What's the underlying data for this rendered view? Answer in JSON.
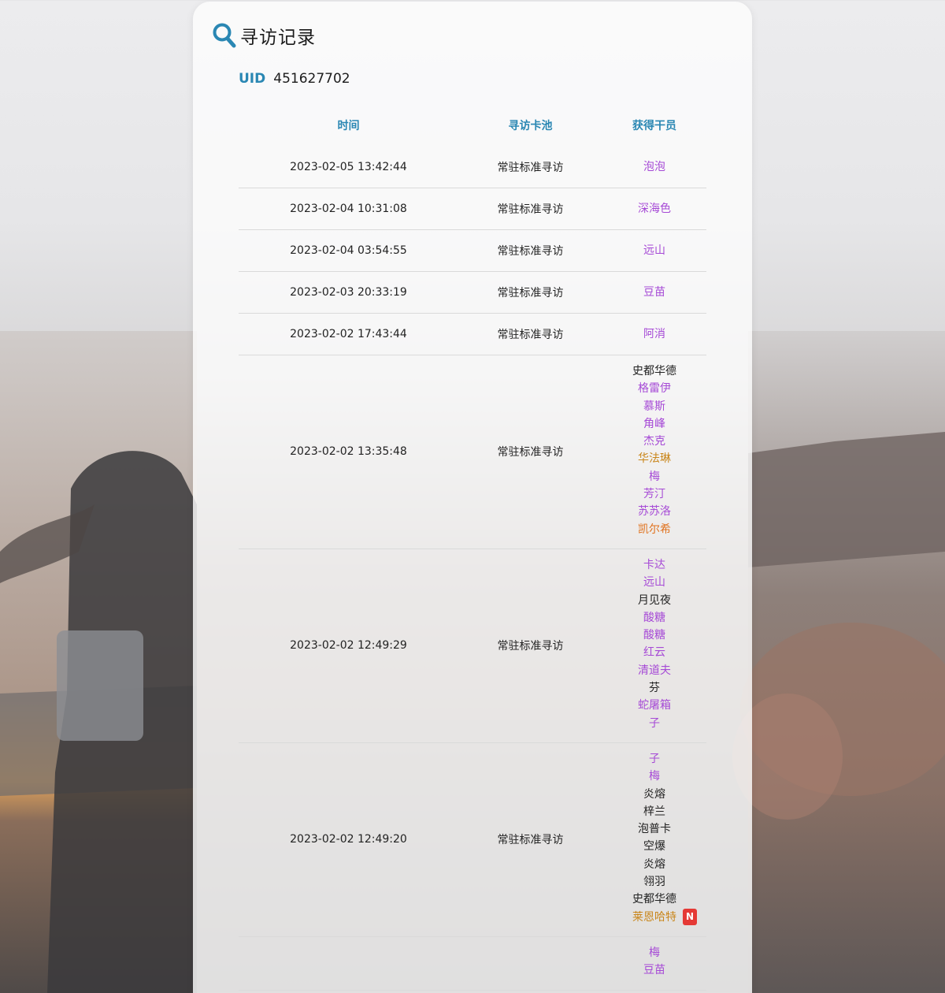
{
  "header": {
    "title": "寻访记录",
    "icon": "search-icon",
    "accent": "#2a87b3"
  },
  "uid": {
    "label": "UID",
    "value": "451627702"
  },
  "table": {
    "columns": [
      "时间",
      "寻访卡池",
      "获得干员"
    ],
    "rows": [
      {
        "time": "2023-02-05 13:42:44",
        "pool": "常驻标准寻访",
        "operators": [
          {
            "name": "泡泡",
            "rarity": 4
          }
        ]
      },
      {
        "time": "2023-02-04 10:31:08",
        "pool": "常驻标准寻访",
        "operators": [
          {
            "name": "深海色",
            "rarity": 4
          }
        ]
      },
      {
        "time": "2023-02-04 03:54:55",
        "pool": "常驻标准寻访",
        "operators": [
          {
            "name": "远山",
            "rarity": 4
          }
        ]
      },
      {
        "time": "2023-02-03 20:33:19",
        "pool": "常驻标准寻访",
        "operators": [
          {
            "name": "豆苗",
            "rarity": 4
          }
        ]
      },
      {
        "time": "2023-02-02 17:43:44",
        "pool": "常驻标准寻访",
        "operators": [
          {
            "name": "阿消",
            "rarity": 4
          }
        ]
      },
      {
        "time": "2023-02-02 13:35:48",
        "pool": "常驻标准寻访",
        "operators": [
          {
            "name": "史都华德",
            "rarity": 3
          },
          {
            "name": "格雷伊",
            "rarity": 4
          },
          {
            "name": "慕斯",
            "rarity": 4
          },
          {
            "name": "角峰",
            "rarity": 4
          },
          {
            "name": "杰克",
            "rarity": 4
          },
          {
            "name": "华法琳",
            "rarity": 5
          },
          {
            "name": "梅",
            "rarity": 4
          },
          {
            "name": "芳汀",
            "rarity": 4
          },
          {
            "name": "苏苏洛",
            "rarity": 4
          },
          {
            "name": "凯尔希",
            "rarity": 6
          }
        ]
      },
      {
        "time": "2023-02-02 12:49:29",
        "pool": "常驻标准寻访",
        "operators": [
          {
            "name": "卡达",
            "rarity": 4
          },
          {
            "name": "远山",
            "rarity": 4
          },
          {
            "name": "月见夜",
            "rarity": 3
          },
          {
            "name": "酸糖",
            "rarity": 4
          },
          {
            "name": "酸糖",
            "rarity": 4
          },
          {
            "name": "红云",
            "rarity": 4
          },
          {
            "name": "清道夫",
            "rarity": 4
          },
          {
            "name": "芬",
            "rarity": 3
          },
          {
            "name": "蛇屠箱",
            "rarity": 4
          },
          {
            "name": "子",
            "rarity": 4
          }
        ]
      },
      {
        "time": "2023-02-02 12:49:20",
        "pool": "常驻标准寻访",
        "operators": [
          {
            "name": "子",
            "rarity": 4
          },
          {
            "name": "梅",
            "rarity": 4
          },
          {
            "name": "炎熔",
            "rarity": 3
          },
          {
            "name": "梓兰",
            "rarity": 3
          },
          {
            "name": "泡普卡",
            "rarity": 3
          },
          {
            "name": "空爆",
            "rarity": 3
          },
          {
            "name": "炎熔",
            "rarity": 3
          },
          {
            "name": "翎羽",
            "rarity": 3
          },
          {
            "name": "史都华德",
            "rarity": 3
          },
          {
            "name": "莱恩哈特",
            "rarity": 5,
            "new": "N"
          }
        ]
      },
      {
        "time": "",
        "pool": "",
        "operators": [
          {
            "name": "梅",
            "rarity": 4
          },
          {
            "name": "豆苗",
            "rarity": 4
          }
        ]
      }
    ]
  },
  "colors": {
    "rarity3": "#222222",
    "rarity4": "#a64ad6",
    "rarity5": "#c9861b",
    "rarity6": "#e0721f",
    "new_badge": "#e53935"
  }
}
